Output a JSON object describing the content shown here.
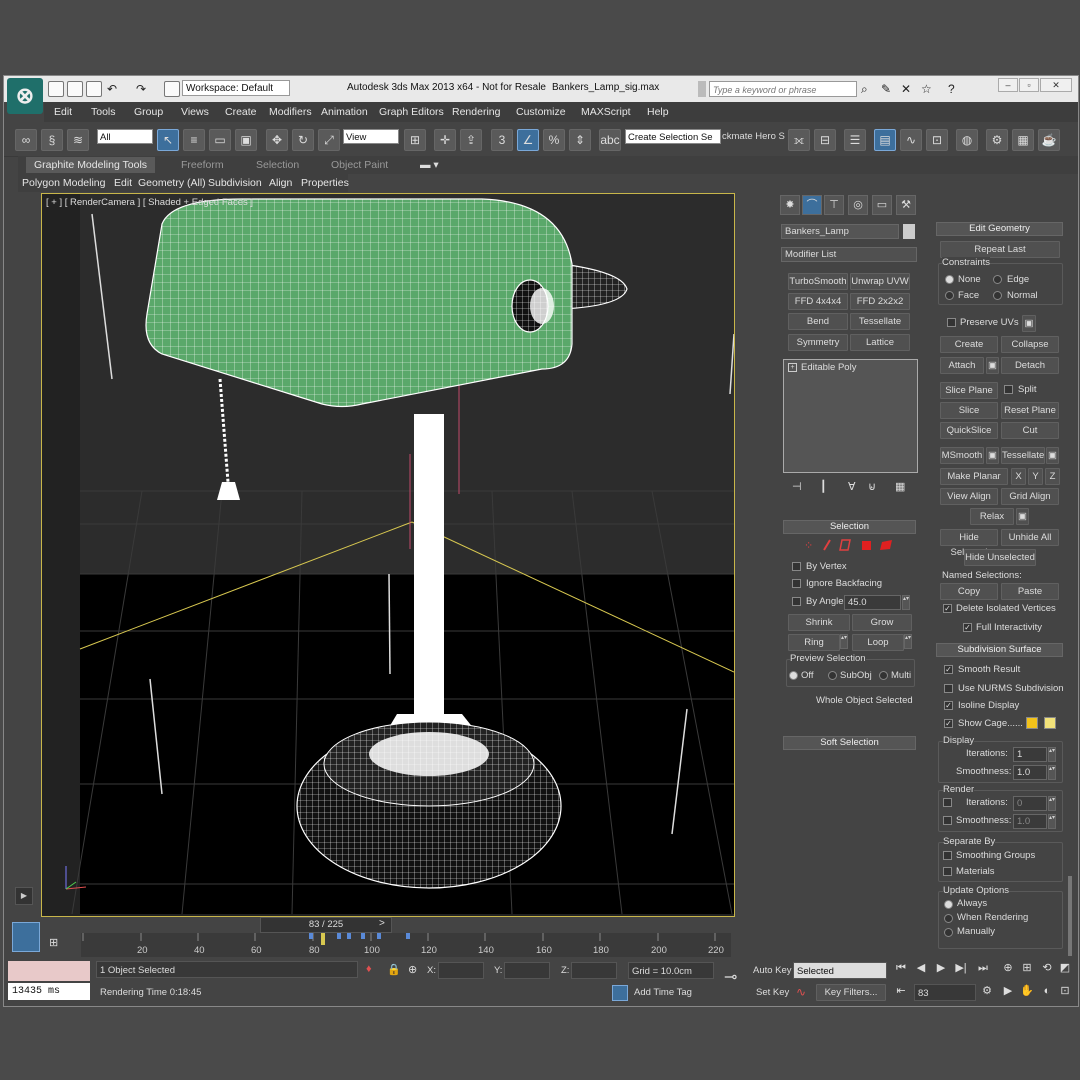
{
  "titlebar": {
    "workspace": "Workspace: Default",
    "app_title": "Autodesk 3ds Max  2013 x64  - Not for Resale",
    "file_name": "Bankers_Lamp_sig.max",
    "search_placeholder": "Type a keyword or phrase"
  },
  "menus": [
    "Edit",
    "Tools",
    "Group",
    "Views",
    "Create",
    "Modifiers",
    "Animation",
    "Graph Editors",
    "Rendering",
    "Customize",
    "MAXScript",
    "Help"
  ],
  "toolbar": {
    "filter_value": "All",
    "ref_coord_value": "View",
    "selection_set_value": "Create Selection Se",
    "named_label": "ckmate Hero S"
  },
  "ribbon": {
    "tabs": [
      "Graphite Modeling Tools",
      "Freeform",
      "Selection",
      "Object Paint"
    ],
    "subtabs": [
      "Polygon Modeling",
      "Edit",
      "Geometry (All)",
      "Subdivision",
      "Align",
      "Properties"
    ]
  },
  "viewport": {
    "label": "[ + ] [ RenderCamera ] [ Shaded + Edged Faces ]"
  },
  "timeline": {
    "frame_display": "83 / 225",
    "ruler_numbers": [
      "20",
      "40",
      "60",
      "80",
      "100",
      "120",
      "140",
      "160",
      "180",
      "200",
      "220"
    ]
  },
  "status": {
    "objects_selected": "1 Object Selected",
    "rendering_time": "Rendering Time  0:18:45",
    "x_label": "X:",
    "y_label": "Y:",
    "z_label": "Z:",
    "grid": "Grid = 10.0cm",
    "add_time_tag": "Add Time Tag",
    "auto_key": "Auto Key",
    "set_key": "Set Key",
    "selected_value": "Selected",
    "key_filters": "Key Filters...",
    "current_frame": "83",
    "ms_value": "13435 ms"
  },
  "modify_panel": {
    "object_name": "Bankers_Lamp",
    "modifier_list": "Modifier List",
    "modifier_buttons": [
      "TurboSmooth",
      "Unwrap UVW",
      "FFD 4x4x4",
      "FFD 2x2x2",
      "Bend",
      "Tessellate",
      "Symmetry",
      "Lattice"
    ],
    "stack_item": "Editable Poly",
    "selection": {
      "title": "Selection",
      "by_vertex": "By Vertex",
      "ignore_backfacing": "Ignore Backfacing",
      "by_angle": "By Angle:",
      "angle_value": "45.0",
      "shrink": "Shrink",
      "grow": "Grow",
      "ring": "Ring",
      "loop": "Loop",
      "preview_title": "Preview Selection",
      "preview_options": [
        "Off",
        "SubObj",
        "Multi"
      ],
      "whole_object": "Whole Object Selected"
    },
    "soft_selection": "Soft Selection"
  },
  "edit_geometry": {
    "title": "Edit Geometry",
    "repeat_last": "Repeat Last",
    "constraints": "Constraints",
    "constraint_options": [
      "None",
      "Edge",
      "Face",
      "Normal"
    ],
    "preserve_uvs": "Preserve UVs",
    "create": "Create",
    "collapse": "Collapse",
    "attach": "Attach",
    "detach": "Detach",
    "slice_plane": "Slice Plane",
    "split": "Split",
    "slice": "Slice",
    "reset_plane": "Reset Plane",
    "quickslice": "QuickSlice",
    "cut": "Cut",
    "msmooth": "MSmooth",
    "tessellate": "Tessellate",
    "make_planar": "Make Planar",
    "x": "X",
    "y": "Y",
    "z": "Z",
    "view_align": "View Align",
    "grid_align": "Grid Align",
    "relax": "Relax",
    "hide_selected": "Hide Selected",
    "unhide_all": "Unhide All",
    "hide_unselected": "Hide Unselected",
    "named_selections": "Named Selections:",
    "copy": "Copy",
    "paste": "Paste",
    "delete_isolated": "Delete Isolated Vertices",
    "full_interactivity": "Full Interactivity"
  },
  "subdivision_surface": {
    "title": "Subdivision Surface",
    "smooth_result": "Smooth Result",
    "use_nurms": "Use NURMS Subdivision",
    "isoline_display": "Isoline Display",
    "show_cage": "Show Cage......",
    "display": "Display",
    "iterations": "Iterations:",
    "iterations_value": "1",
    "smoothness": "Smoothness:",
    "smoothness_value": "1.0",
    "render": "Render",
    "render_iterations_value": "0",
    "render_smoothness_value": "1.0",
    "separate_by": "Separate By",
    "smoothing_groups": "Smoothing Groups",
    "materials": "Materials",
    "update_options": "Update Options",
    "update_values": [
      "Always",
      "When Rendering",
      "Manually"
    ]
  },
  "colors": {
    "cage_color_1": "#f2c21a",
    "cage_color_2": "#f2e27a",
    "shade_green": "#5aa86a"
  }
}
